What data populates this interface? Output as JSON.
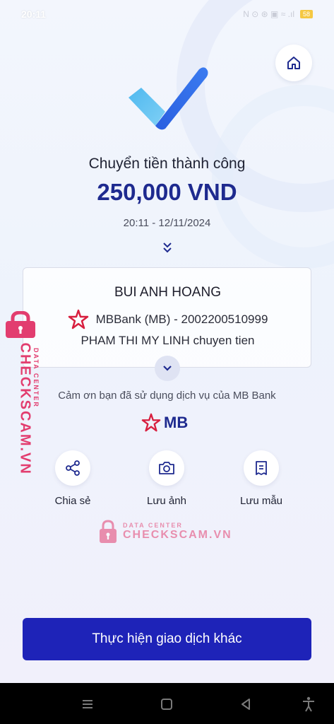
{
  "status_bar": {
    "time": "20:11",
    "indicators": "N ⊙ ⊛ ▣ ≈ .ıl",
    "battery": "58"
  },
  "header": {
    "home_icon": "home-icon"
  },
  "result": {
    "title": "Chuyển tiền thành công",
    "amount": "250,000 VND",
    "datetime": "20:11 - 12/11/2024"
  },
  "card": {
    "recipient_name": "BUI ANH HOANG",
    "bank_account": "MBBank (MB) - 2002200510999",
    "message": "PHAM THI MY LINH chuyen tien"
  },
  "footer_note": {
    "thanks": "Cảm ơn bạn đã sử dụng dịch vụ của MB Bank",
    "logo_text": "MB"
  },
  "actions": [
    {
      "label": "Chia sẻ",
      "icon": "share-icon"
    },
    {
      "label": "Lưu ảnh",
      "icon": "camera-icon"
    },
    {
      "label": "Lưu mẫu",
      "icon": "receipt-icon"
    }
  ],
  "watermark": {
    "small": "DATA CENTER",
    "big": "CHECKSCAM.VN"
  },
  "primary_button": {
    "label": "Thực hiện giao dịch khác"
  },
  "colors": {
    "brand_blue": "#1e2a8f",
    "button_blue": "#1e23b8",
    "watermark_pink": "#e23d6f",
    "mb_red": "#d81f3f"
  }
}
